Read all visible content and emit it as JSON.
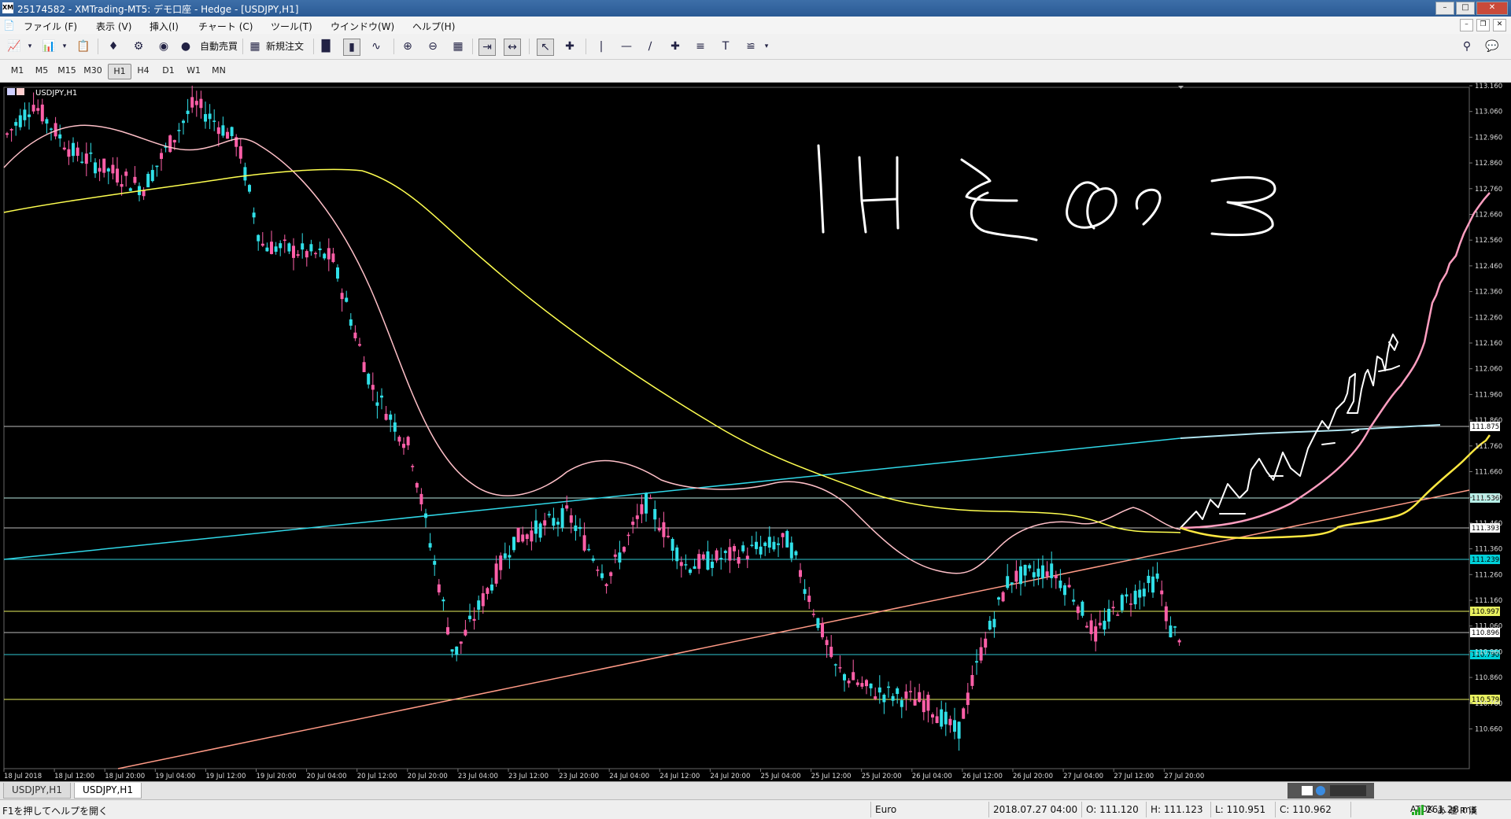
{
  "window": {
    "title": "25174582 - XMTrading-MT5: デモ口座 - Hedge - [USDJPY,H1]",
    "app_icon": "XM"
  },
  "menu": [
    "ファイル (F)",
    "表示 (V)",
    "挿入(I)",
    "チャート (C)",
    "ツール(T)",
    "ウインドウ(W)",
    "ヘルプ(H)"
  ],
  "toolbar": {
    "auto_trade_label": "自動売買",
    "new_order_label": "新規注文"
  },
  "timeframes": [
    "M1",
    "M5",
    "M15",
    "M30",
    "H1",
    "H4",
    "D1",
    "W1",
    "MN"
  ],
  "active_timeframe": "H1",
  "chart": {
    "symbol_label": "USDJPY,H1",
    "handwritten_note": "1Hその3",
    "price_axis": [
      "113.160",
      "113.060",
      "112.960",
      "112.860",
      "112.760",
      "112.660",
      "112.560",
      "112.460",
      "112.360",
      "112.260",
      "112.160",
      "112.060",
      "111.960",
      "111.860",
      "111.760",
      "111.660",
      "111.560",
      "111.460",
      "111.360",
      "111.260",
      "111.160",
      "111.060",
      "110.960",
      "110.860",
      "110.760",
      "110.660"
    ],
    "price_tags": [
      {
        "label": "111.875",
        "color": "#ffffff"
      },
      {
        "label": "111.536",
        "color": "#b8f0e8"
      },
      {
        "label": "111.393",
        "color": "#ffffff"
      },
      {
        "label": "111.239",
        "color": "#00d0d8"
      },
      {
        "label": "110.997",
        "color": "#e8f060"
      },
      {
        "label": "110.896",
        "color": "#ffffff"
      },
      {
        "label": "110.790",
        "color": "#00d0d8"
      },
      {
        "label": "110.579",
        "color": "#e8f060"
      }
    ],
    "time_axis": [
      "18 Jul 2018",
      "18 Jul 12:00",
      "18 Jul 20:00",
      "19 Jul 04:00",
      "19 Jul 12:00",
      "19 Jul 20:00",
      "20 Jul 04:00",
      "20 Jul 12:00",
      "20 Jul 20:00",
      "23 Jul 04:00",
      "23 Jul 12:00",
      "23 Jul 20:00",
      "24 Jul 04:00",
      "24 Jul 12:00",
      "24 Jul 20:00",
      "25 Jul 04:00",
      "25 Jul 12:00",
      "25 Jul 20:00",
      "26 Jul 04:00",
      "26 Jul 12:00",
      "26 Jul 20:00",
      "27 Jul 04:00",
      "27 Jul 12:00",
      "27 Jul 20:00"
    ],
    "colors": {
      "bull": "#ff5fa8",
      "bear": "#30e0e8",
      "ma_short": "#ffc0c8",
      "ma_long": "#ffff50",
      "trend_cyan": "#30d8e8",
      "trend_salmon": "#ff9a86"
    }
  },
  "tabs": [
    "USDJPY,H1",
    "USDJPY,H1"
  ],
  "active_tab": 1,
  "status": {
    "help": "F1を押してヘルプを開く",
    "profile": "Euro",
    "datetime": "2018.07.27 04:00",
    "open": "O: 111.120",
    "high": "H: 111.123",
    "low": "L: 110.951",
    "close": "C: 110.962",
    "ime": "ATOK",
    "ime_modes": "あ 連 R 漢",
    "ping": "261.28 ms"
  }
}
